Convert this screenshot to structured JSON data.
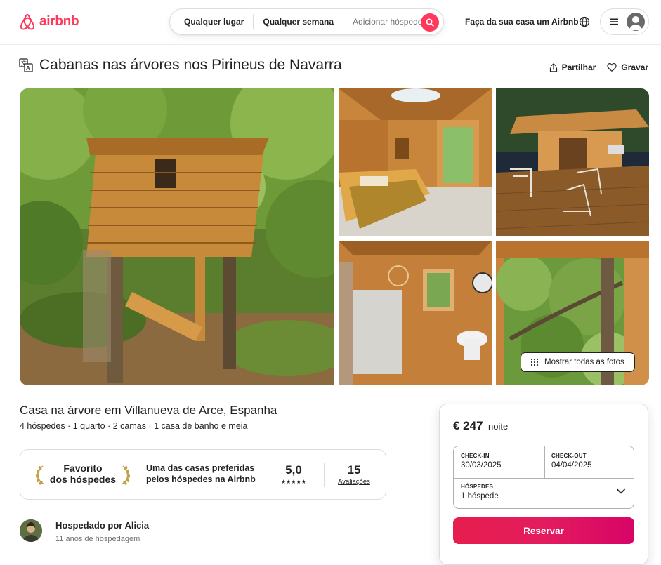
{
  "header": {
    "logo_text": "airbnb",
    "search": {
      "location": "Qualquer lugar",
      "week": "Qualquer semana",
      "guests": "Adicionar hóspedes"
    },
    "host_link": "Faça da sua casa um Airbnb"
  },
  "listing": {
    "title": "Cabanas nas árvores nos Pirineus de Navarra",
    "share": "Partilhar",
    "save": "Gravar",
    "show_all_photos": "Mostrar todas as fotos",
    "subtitle": "Casa na árvore em Villanueva de Arce, Espanha",
    "details": "4 hóspedes · 1 quarto · 2 camas · 1 casa de banho e meia"
  },
  "guest_favorite": {
    "badge_line1": "Favorito",
    "badge_line2": "dos hóspedes",
    "description": "Uma das casas preferidas pelos hóspedes na Airbnb",
    "rating": "5,0",
    "stars": "★★★★★",
    "reviews_count": "15",
    "reviews_label": "Avaliações"
  },
  "host": {
    "name": "Hospedado por Alicia",
    "years": "11 anos de hospedagem"
  },
  "booking": {
    "price": "€ 247",
    "price_unit": "noite",
    "checkin_label": "CHECK-IN",
    "checkin_value": "30/03/2025",
    "checkout_label": "CHECK-OUT",
    "checkout_value": "04/04/2025",
    "guests_label": "HÓSPEDES",
    "guests_value": "1 hóspede",
    "reserve": "Reservar"
  },
  "colors": {
    "brand": "#ff385c",
    "reserve_gradient_start": "#e61e4d",
    "reserve_gradient_end": "#d70466"
  }
}
